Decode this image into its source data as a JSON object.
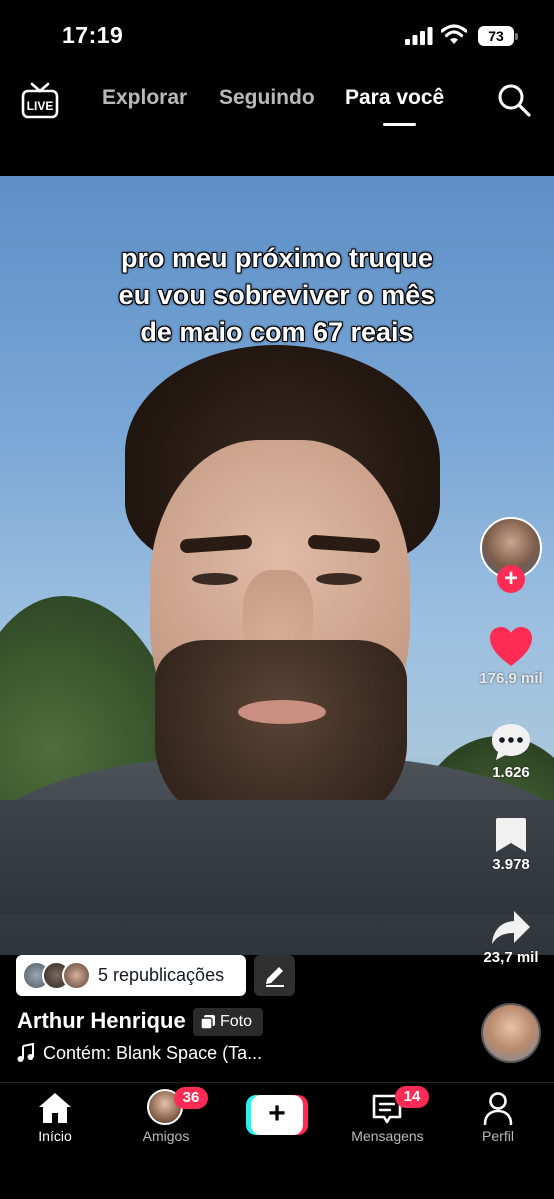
{
  "status_bar": {
    "time": "17:19",
    "battery": "73"
  },
  "top_nav": {
    "live_icon": "live-tv-icon",
    "tabs": [
      {
        "label": "Explorar",
        "active": false
      },
      {
        "label": "Seguindo",
        "active": false
      },
      {
        "label": "Para você",
        "active": true
      }
    ],
    "search_icon": "search-icon"
  },
  "video": {
    "caption_lines": [
      "pro meu próximo truque",
      "eu vou sobreviver o mês",
      "de maio com 67 reais"
    ]
  },
  "rail": {
    "likes": "176,9 mil",
    "comments": "1.626",
    "saves": "3.978",
    "shares": "23,7 mil",
    "like_color": "#fe2c55"
  },
  "post_info": {
    "reposts_label": "5 republicações",
    "author": "Arthur Henrique",
    "photo_badge": "Foto",
    "music": "Contém: Blank Space (Ta..."
  },
  "bottom_nav": {
    "items": [
      {
        "label": "Início",
        "icon": "home-icon",
        "active": true
      },
      {
        "label": "Amigos",
        "icon": "friends-avatar",
        "badge": "36"
      },
      {
        "label": "",
        "icon": "create-plus-icon"
      },
      {
        "label": "Mensagens",
        "icon": "inbox-icon",
        "badge": "14"
      },
      {
        "label": "Perfil",
        "icon": "profile-icon"
      }
    ]
  },
  "colors": {
    "accent": "#fe2c55",
    "cyan": "#25f4ee",
    "background": "#000000"
  }
}
